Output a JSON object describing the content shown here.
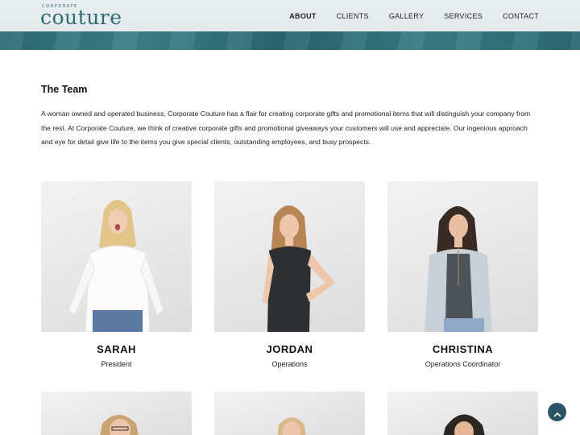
{
  "header": {
    "logo_small": "CORPORATE",
    "logo_main": "couture",
    "nav": [
      {
        "label": "ABOUT",
        "active": true
      },
      {
        "label": "CLIENTS",
        "active": false
      },
      {
        "label": "GALLERY",
        "active": false
      },
      {
        "label": "SERVICES",
        "active": false
      },
      {
        "label": "CONTACT",
        "active": false
      }
    ]
  },
  "team": {
    "title": "The Team",
    "intro": "A woman owned and operated business, Corporate Couture has a flair for creating corporate gifts and promotional items that will distinguish your company from the rest. At Corporate Couture, we think of creative corporate gifts and promotional giveaways your customers will use and appreciate. Our ingenious approach and eye for detail give life to the items you give special clients, outstanding employees, and busy prospects.",
    "members": [
      {
        "name": "SARAH",
        "role": "President"
      },
      {
        "name": "JORDAN",
        "role": "Operations"
      },
      {
        "name": "CHRISTINA",
        "role": "Operations Coordinator"
      }
    ]
  },
  "scroll_top": {
    "icon": "chevron-up-icon"
  },
  "colors": {
    "brand": "#2f6d74",
    "scroll_button": "#2b5566"
  }
}
